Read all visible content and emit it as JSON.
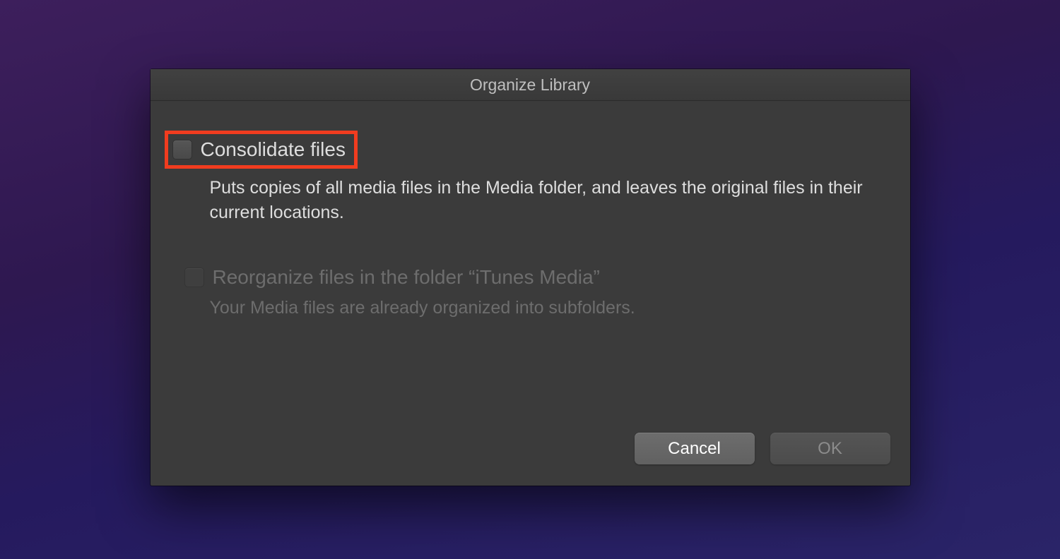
{
  "dialog": {
    "title": "Organize Library",
    "options": [
      {
        "label": "Consolidate files",
        "description": "Puts copies of all media files in the Media folder, and leaves the original files in their current locations.",
        "checked": false,
        "enabled": true,
        "highlighted": true
      },
      {
        "label": "Reorganize files in the folder “iTunes Media”",
        "description": "Your Media files are already organized into subfolders.",
        "checked": false,
        "enabled": false,
        "highlighted": false
      }
    ],
    "buttons": {
      "cancel": "Cancel",
      "ok": "OK"
    }
  },
  "colors": {
    "highlight_border": "#f13c1f",
    "dialog_bg": "#3b3b3b"
  }
}
